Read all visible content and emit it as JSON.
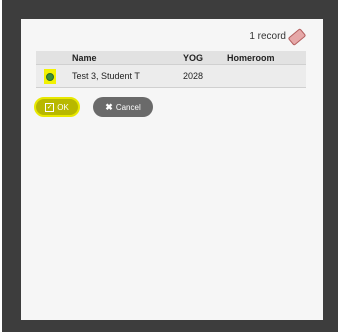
{
  "header": {
    "record_count": "1 record",
    "clear_icon": "eraser-icon"
  },
  "table": {
    "columns": [
      "",
      "Name",
      "YOG",
      "Homeroom"
    ],
    "rows": [
      {
        "selected": true,
        "name": "Test 3, Student T",
        "yog": "2028",
        "homeroom": ""
      }
    ]
  },
  "buttons": {
    "ok": "OK",
    "cancel": "Cancel"
  },
  "colors": {
    "highlight": "#f2f200",
    "ok_bg": "#b8b800",
    "cancel_bg": "#6a6a6a"
  }
}
